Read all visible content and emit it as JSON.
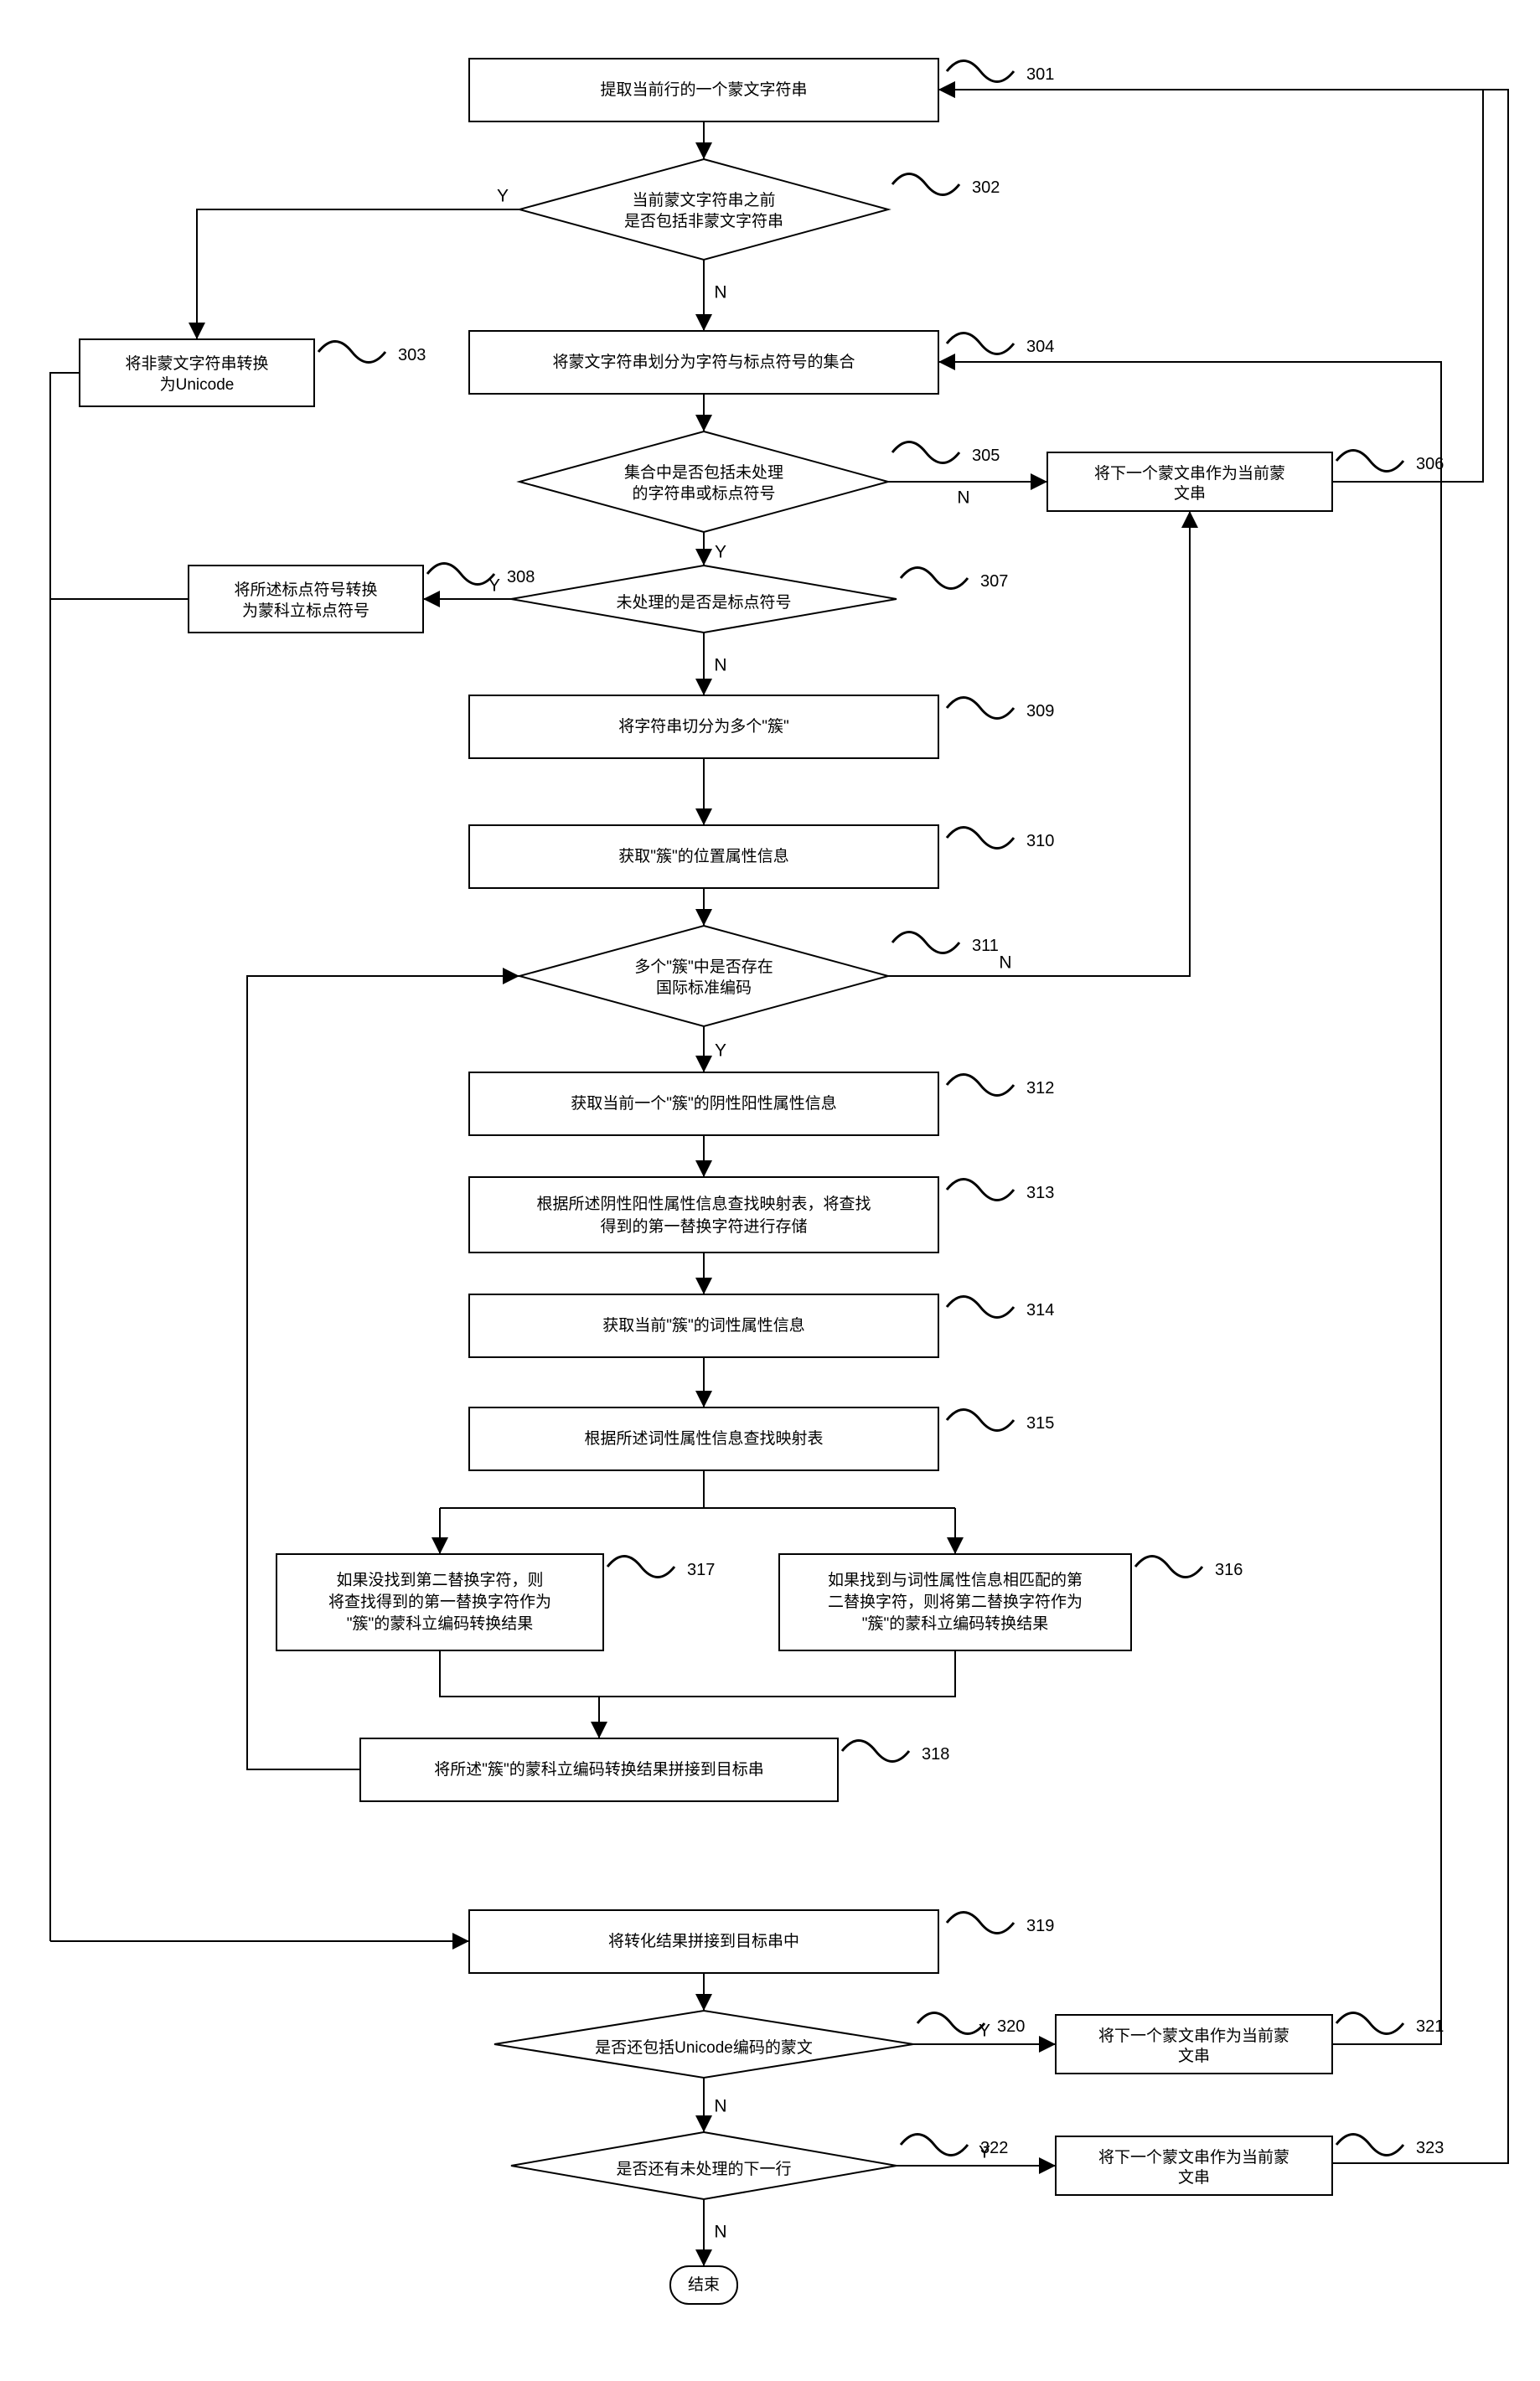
{
  "chart_data": {
    "type": "flowchart",
    "nodes": [
      {
        "id": "301",
        "type": "process",
        "label": "提取当前行的一个蒙文字符串"
      },
      {
        "id": "302",
        "type": "decision",
        "label": "当前蒙文字符串之前是否包括非蒙文字符串"
      },
      {
        "id": "303",
        "type": "process",
        "label": "将非蒙文字符串转换为Unicode"
      },
      {
        "id": "304",
        "type": "process",
        "label": "将蒙文字符串划分为字符与标点符号的集合"
      },
      {
        "id": "305",
        "type": "decision",
        "label": "集合中是否包括未处理的字符串或标点符号"
      },
      {
        "id": "306",
        "type": "process",
        "label": "将下一个蒙文串作为当前蒙文串"
      },
      {
        "id": "307",
        "type": "decision",
        "label": "未处理的是否是标点符号"
      },
      {
        "id": "308",
        "type": "process",
        "label": "将所述标点符号转换为蒙科立标点符号"
      },
      {
        "id": "309",
        "type": "process",
        "label": "将字符串切分为多个\"簇\""
      },
      {
        "id": "310",
        "type": "process",
        "label": "获取\"簇\"的位置属性信息"
      },
      {
        "id": "311",
        "type": "decision",
        "label": "多个\"簇\"中是否存在国际标准编码"
      },
      {
        "id": "312",
        "type": "process",
        "label": "获取当前一个\"簇\"的阴性阳性属性信息"
      },
      {
        "id": "313",
        "type": "process",
        "label": "根据所述阴性阳性属性信息查找映射表，将查找得到的第一替换字符进行存储"
      },
      {
        "id": "314",
        "type": "process",
        "label": "获取当前\"簇\"的词性属性信息"
      },
      {
        "id": "315",
        "type": "process",
        "label": "根据所述词性属性信息查找映射表"
      },
      {
        "id": "316",
        "type": "process",
        "label": "如果找到与词性属性信息相匹配的第二替换字符，则将第二替换字符作为\"簇\"的蒙科立编码转换结果"
      },
      {
        "id": "317",
        "type": "process",
        "label": "如果没找到第二替换字符，则将查找得到的第一替换字符作为\"簇\"的蒙科立编码转换结果"
      },
      {
        "id": "318",
        "type": "process",
        "label": "将所述\"簇\"的蒙科立编码转换结果拼接到目标串"
      },
      {
        "id": "319",
        "type": "process",
        "label": "将转化结果拼接到目标串中"
      },
      {
        "id": "320",
        "type": "decision",
        "label": "是否还包括Unicode编码的蒙文"
      },
      {
        "id": "321",
        "type": "process",
        "label": "将下一个蒙文串作为当前蒙文串"
      },
      {
        "id": "322",
        "type": "decision",
        "label": "是否还有未处理的下一行"
      },
      {
        "id": "323",
        "type": "process",
        "label": "将下一个蒙文串作为当前蒙文串"
      },
      {
        "id": "end",
        "type": "terminator",
        "label": "结束"
      }
    ],
    "edges": [
      {
        "from": "301",
        "to": "302"
      },
      {
        "from": "302",
        "to": "303",
        "label": "Y"
      },
      {
        "from": "302",
        "to": "304",
        "label": "N"
      },
      {
        "from": "304",
        "to": "305"
      },
      {
        "from": "305",
        "to": "306",
        "label": "N"
      },
      {
        "from": "305",
        "to": "307",
        "label": "Y"
      },
      {
        "from": "307",
        "to": "308",
        "label": "Y"
      },
      {
        "from": "307",
        "to": "309",
        "label": "N"
      },
      {
        "from": "309",
        "to": "310"
      },
      {
        "from": "310",
        "to": "311"
      },
      {
        "from": "311",
        "to": "312",
        "label": "Y"
      },
      {
        "from": "311",
        "to": "306",
        "label": "N"
      },
      {
        "from": "312",
        "to": "313"
      },
      {
        "from": "313",
        "to": "314"
      },
      {
        "from": "314",
        "to": "315"
      },
      {
        "from": "315",
        "to": "316"
      },
      {
        "from": "315",
        "to": "317"
      },
      {
        "from": "316",
        "to": "318"
      },
      {
        "from": "317",
        "to": "318"
      },
      {
        "from": "318",
        "to": "311"
      },
      {
        "from": "319",
        "to": "320"
      },
      {
        "from": "320",
        "to": "321",
        "label": "Y"
      },
      {
        "from": "320",
        "to": "322",
        "label": "N"
      },
      {
        "from": "322",
        "to": "323",
        "label": "Y"
      },
      {
        "from": "322",
        "to": "end",
        "label": "N"
      },
      {
        "from": "303",
        "to": "319"
      },
      {
        "from": "308",
        "to": "319"
      },
      {
        "from": "306",
        "to": "301"
      },
      {
        "from": "321",
        "to": "304"
      },
      {
        "from": "323",
        "to": "301"
      }
    ]
  },
  "labels": {
    "Y": "Y",
    "N": "N",
    "n301": "提取当前行的一个蒙文字符串",
    "n302a": "当前蒙文字符串之前",
    "n302b": "是否包括非蒙文字符串",
    "n303a": "将非蒙文字符串转换",
    "n303b": "为Unicode",
    "n304": "将蒙文字符串划分为字符与标点符号的集合",
    "n305a": "集合中是否包括未处理",
    "n305b": "的字符串或标点符号",
    "n306a": "将下一个蒙文串作为当前蒙",
    "n306b": "文串",
    "n307": "未处理的是否是标点符号",
    "n308a": "将所述标点符号转换",
    "n308b": "为蒙科立标点符号",
    "n309": "将字符串切分为多个\"簇\"",
    "n310": "获取\"簇\"的位置属性信息",
    "n311a": "多个\"簇\"中是否存在",
    "n311b": "国际标准编码",
    "n312": "获取当前一个\"簇\"的阴性阳性属性信息",
    "n313a": "根据所述阴性阳性属性信息查找映射表，将查找",
    "n313b": "得到的第一替换字符进行存储",
    "n314": "获取当前\"簇\"的词性属性信息",
    "n315": "根据所述词性属性信息查找映射表",
    "n316a": "如果找到与词性属性信息相匹配的第",
    "n316b": "二替换字符，则将第二替换字符作为",
    "n316c": "\"簇\"的蒙科立编码转换结果",
    "n317a": "如果没找到第二替换字符，则",
    "n317b": "将查找得到的第一替换字符作为",
    "n317c": "\"簇\"的蒙科立编码转换结果",
    "n318": "将所述\"簇\"的蒙科立编码转换结果拼接到目标串",
    "n319": "将转化结果拼接到目标串中",
    "n320": "是否还包括Unicode编码的蒙文",
    "n321a": "将下一个蒙文串作为当前蒙",
    "n321b": "文串",
    "n322": "是否还有未处理的下一行",
    "n323a": "将下一个蒙文串作为当前蒙",
    "n323b": "文串",
    "end": "结束",
    "num301": "301",
    "num302": "302",
    "num303": "303",
    "num304": "304",
    "num305": "305",
    "num306": "306",
    "num307": "307",
    "num308": "308",
    "num309": "309",
    "num310": "310",
    "num311": "311",
    "num312": "312",
    "num313": "313",
    "num314": "314",
    "num315": "315",
    "num316": "316",
    "num317": "317",
    "num318": "318",
    "num319": "319",
    "num320": "320",
    "num321": "321",
    "num322": "322",
    "num323": "323"
  }
}
